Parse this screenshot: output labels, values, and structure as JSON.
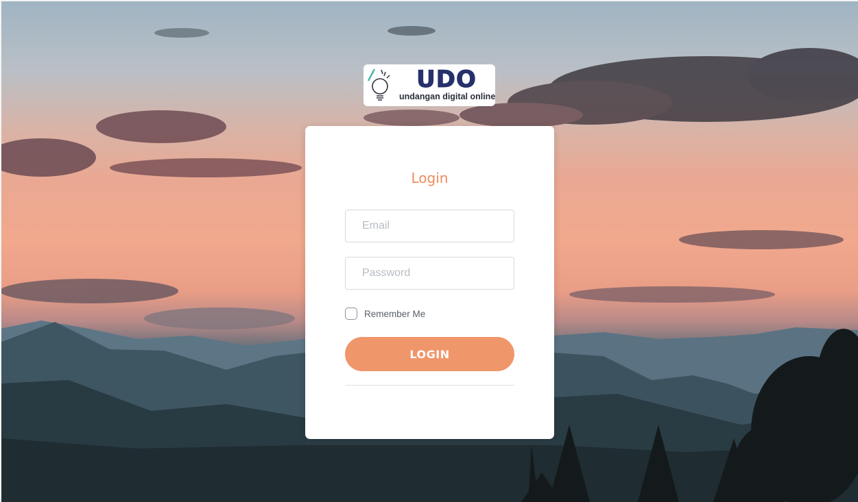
{
  "logo": {
    "title": "UDO",
    "subtitle": "undangan digital online",
    "icon": "lightbulb-icon"
  },
  "login_form": {
    "title": "Login",
    "email": {
      "placeholder": "Email",
      "value": ""
    },
    "password": {
      "placeholder": "Password",
      "value": ""
    },
    "remember_me": {
      "label": "Remember Me",
      "checked": false
    },
    "submit_label": "LOGIN"
  },
  "colors": {
    "accent": "#f0966b",
    "title": "#ef8b5e",
    "logo_text": "#26306b"
  }
}
